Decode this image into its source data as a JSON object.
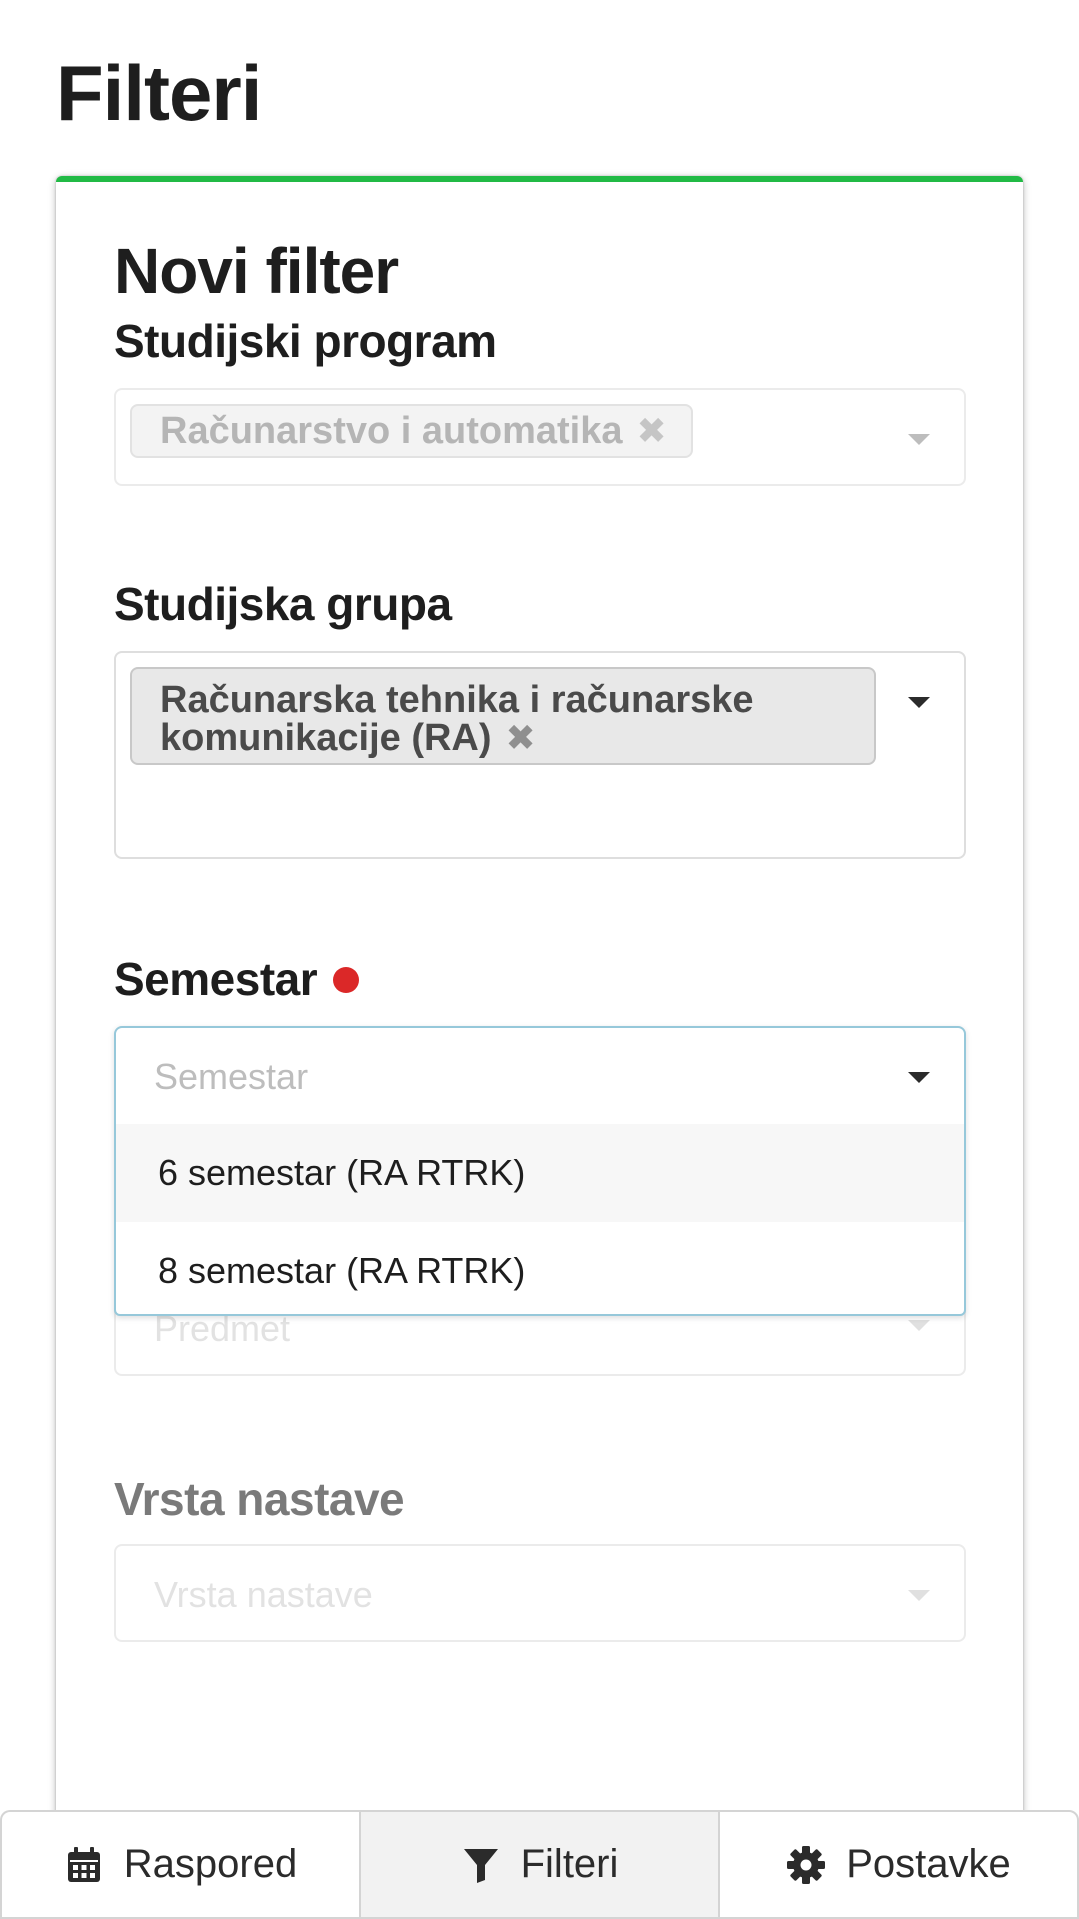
{
  "page": {
    "title": "Filteri"
  },
  "card": {
    "title": "Novi filter"
  },
  "study_program": {
    "label": "Studijski program",
    "chip": "Računarstvo i automatika",
    "chip_remove": "✖"
  },
  "study_group": {
    "label": "Studijska grupa",
    "chip_line1": "Računarska tehnika i računarske",
    "chip_line2": "komunikacije (RA)",
    "chip_remove": "✖"
  },
  "semester": {
    "label": "Semestar",
    "placeholder": "Semestar",
    "options": [
      {
        "label": "6 semestar (RA RTRK)"
      },
      {
        "label": "8 semestar (RA RTRK)"
      }
    ]
  },
  "subject": {
    "placeholder": "Predmet"
  },
  "teaching_type": {
    "label": "Vrsta nastave",
    "placeholder": "Vrsta nastave"
  },
  "bottom_nav": {
    "items": [
      {
        "label": "Raspored",
        "icon": "calendar-icon",
        "active": false
      },
      {
        "label": "Filteri",
        "icon": "filter-icon",
        "active": true
      },
      {
        "label": "Postavke",
        "icon": "gear-icon",
        "active": false
      }
    ]
  },
  "colors": {
    "accent_green": "#21ba45",
    "required_red": "#db2828",
    "active_border": "#96c8da"
  }
}
